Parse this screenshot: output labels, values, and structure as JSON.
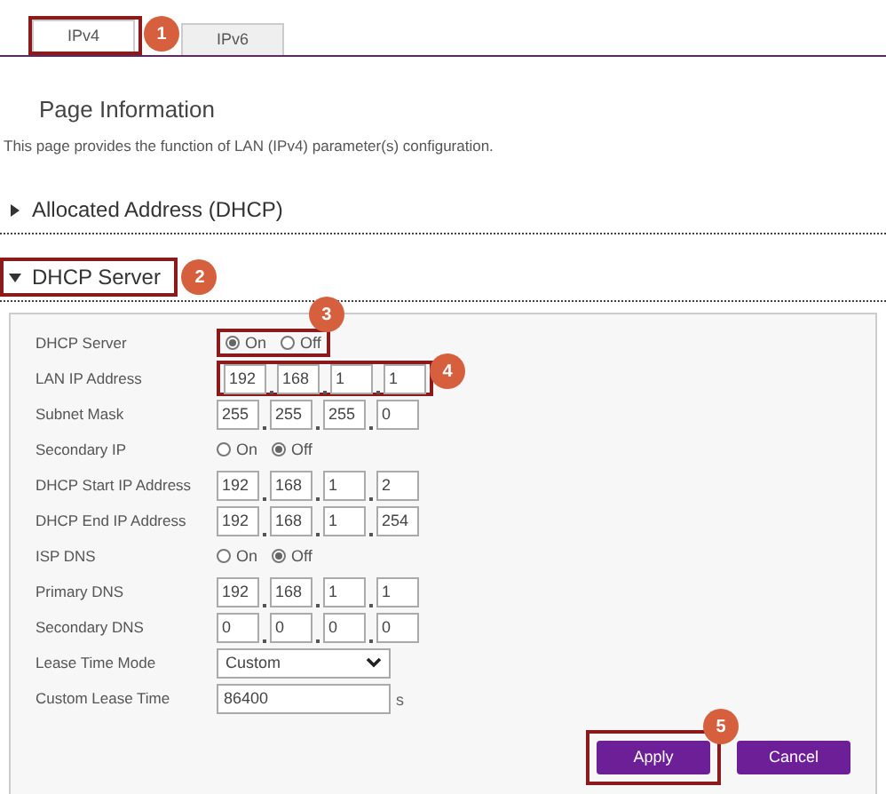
{
  "tabs": [
    {
      "label": "IPv4",
      "selected": true
    },
    {
      "label": "IPv6",
      "selected": false
    }
  ],
  "page_title": "Page Information",
  "description": "This page provides the function of LAN (IPv4) parameter(s) configuration.",
  "sections": [
    {
      "title": "Allocated Address (DHCP)",
      "expanded": false
    },
    {
      "title": "DHCP Server",
      "expanded": true
    }
  ],
  "fields": [
    {
      "kind": "radio",
      "label": "DHCP Server",
      "options": [
        {
          "label": "On",
          "selected": true
        },
        {
          "label": "Off",
          "selected": false
        }
      ]
    },
    {
      "kind": "ip",
      "label": "LAN IP Address",
      "octets": [
        "192",
        "168",
        "1",
        "1"
      ]
    },
    {
      "kind": "ip",
      "label": "Subnet Mask",
      "octets": [
        "255",
        "255",
        "255",
        "0"
      ]
    },
    {
      "kind": "radio",
      "label": "Secondary IP",
      "options": [
        {
          "label": "On",
          "selected": false
        },
        {
          "label": "Off",
          "selected": true
        }
      ]
    },
    {
      "kind": "ip",
      "label": "DHCP Start IP Address",
      "octets": [
        "192",
        "168",
        "1",
        "2"
      ]
    },
    {
      "kind": "ip",
      "label": "DHCP End IP Address",
      "octets": [
        "192",
        "168",
        "1",
        "254"
      ]
    },
    {
      "kind": "radio",
      "label": "ISP DNS",
      "options": [
        {
          "label": "On",
          "selected": false
        },
        {
          "label": "Off",
          "selected": true
        }
      ]
    },
    {
      "kind": "ip",
      "label": "Primary DNS",
      "octets": [
        "192",
        "168",
        "1",
        "1"
      ]
    },
    {
      "kind": "ip",
      "label": "Secondary DNS",
      "octets": [
        "0",
        "0",
        "0",
        "0"
      ]
    },
    {
      "kind": "select",
      "label": "Lease Time Mode",
      "value": "Custom"
    },
    {
      "kind": "text",
      "label": "Custom Lease Time",
      "value": "86400",
      "unit": "s"
    }
  ],
  "buttons": [
    "Apply",
    "Cancel"
  ],
  "callouts": [
    "1",
    "2",
    "3",
    "4",
    "5"
  ]
}
